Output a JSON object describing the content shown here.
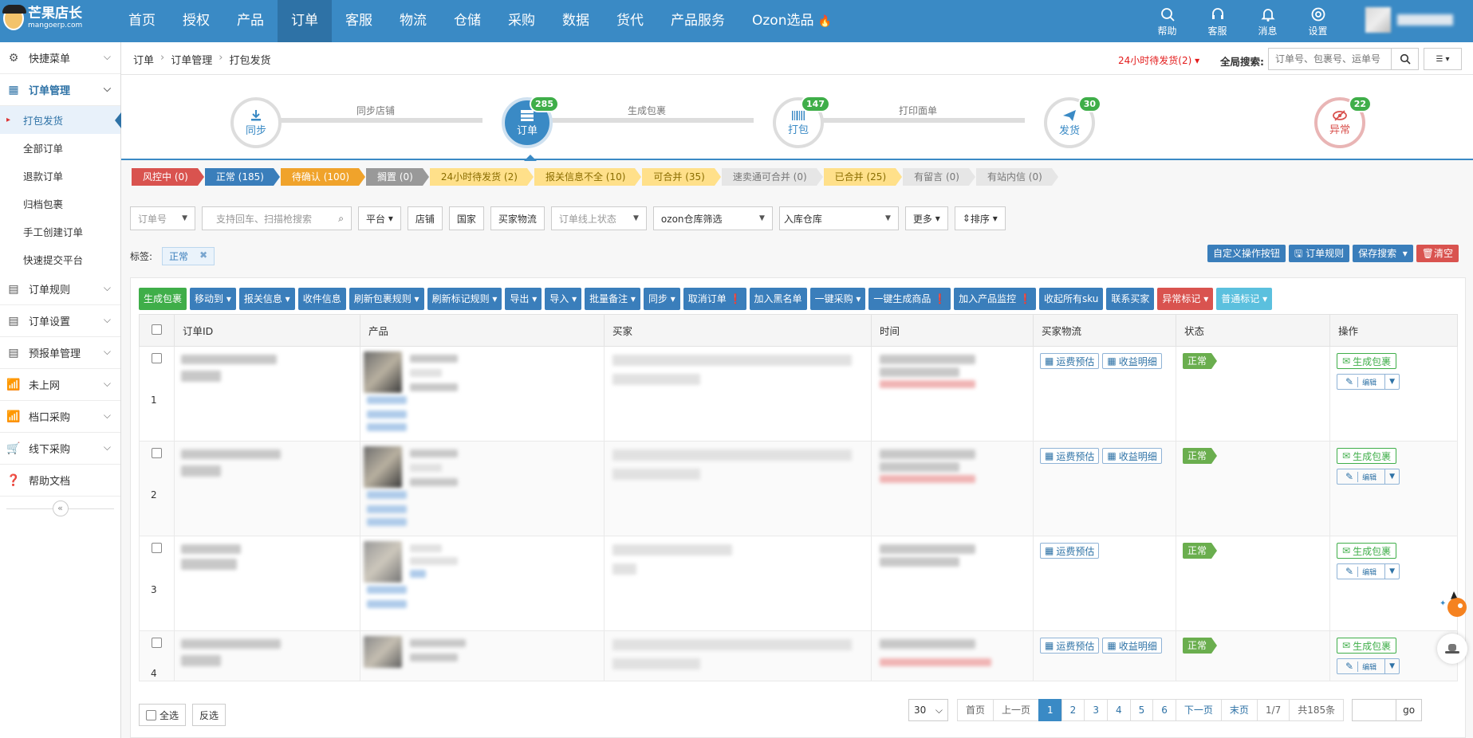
{
  "brand": {
    "name_cn": "芒果店长",
    "name_en": "mangoerp.com"
  },
  "topnav": {
    "items": [
      "首页",
      "授权",
      "产品",
      "订单",
      "客服",
      "物流",
      "仓储",
      "采购",
      "数据",
      "货代",
      "产品服务",
      "Ozon选品"
    ],
    "active": "订单",
    "icons": [
      {
        "label": "帮助",
        "icon": "search-icon"
      },
      {
        "label": "客服",
        "icon": "headset-icon"
      },
      {
        "label": "消息",
        "icon": "bell-icon"
      },
      {
        "label": "设置",
        "icon": "gear-icon"
      }
    ]
  },
  "sidebar": {
    "items": [
      {
        "label": "快捷菜单",
        "icon": "gear-icon"
      },
      {
        "label": "订单管理",
        "icon": "grid-icon"
      },
      {
        "label": "订单规则",
        "icon": "doc-icon"
      },
      {
        "label": "订单设置",
        "icon": "doc-icon"
      },
      {
        "label": "预报单管理",
        "icon": "doc-icon"
      },
      {
        "label": "未上网",
        "icon": "wifi-icon"
      },
      {
        "label": "档口采购",
        "icon": "wifi-icon"
      },
      {
        "label": "线下采购",
        "icon": "cart-icon"
      },
      {
        "label": "帮助文档",
        "icon": "question-icon"
      }
    ],
    "sub_items": [
      "打包发货",
      "全部订单",
      "退款订单",
      "归档包裹",
      "手工创建订单",
      "快速提交平台"
    ],
    "active_sub": "打包发货",
    "collapse": "«"
  },
  "breadcrumb": [
    "订单",
    "订单管理",
    "打包发货"
  ],
  "header": {
    "pending": "24小时待发货(2)",
    "global_search_label": "全局搜索:",
    "global_search_placeholder": "订单号、包裹号、运单号"
  },
  "steps": [
    {
      "label": "同步",
      "badge": ""
    },
    {
      "label": "订单",
      "badge": "285"
    },
    {
      "label": "打包",
      "badge": "147"
    },
    {
      "label": "发货",
      "badge": "30"
    },
    {
      "label": "异常",
      "badge": "22"
    }
  ],
  "step_links": [
    "同步店铺",
    "生成包裹",
    "打印面单"
  ],
  "status_tags": [
    {
      "label": "风控中 (0)",
      "style": "red"
    },
    {
      "label": "正常 (185)",
      "style": "blue"
    },
    {
      "label": "待确认 (100)",
      "style": "orange"
    },
    {
      "label": "搁置 (0)",
      "style": "gray"
    },
    {
      "label": "24小时待发货 (2)",
      "style": "yellow"
    },
    {
      "label": "报关信息不全 (10)",
      "style": "yellow"
    },
    {
      "label": "可合并 (35)",
      "style": "yellow"
    },
    {
      "label": "速卖通可合并 (0)",
      "style": "lightgray"
    },
    {
      "label": "已合并 (25)",
      "style": "yellow"
    },
    {
      "label": "有留言 (0)",
      "style": "lightgray"
    },
    {
      "label": "有站内信 (0)",
      "style": "lightgray"
    }
  ],
  "filters": {
    "order_no": "订单号",
    "scan_placeholder": "支持回车、扫描枪搜索",
    "platform": "平台",
    "shop": "店铺",
    "country": "国家",
    "buyer_logistics": "买家物流",
    "online_status": "订单线上状态",
    "ozon_warehouse": "ozon仓库筛选",
    "in_warehouse": "入库仓库",
    "more": "更多",
    "sort": "排序"
  },
  "label_filter": {
    "label": "标签:",
    "tag": "正常",
    "remove": "✖"
  },
  "right_buttons": [
    "自定义操作按钮",
    "订单规则",
    "保存搜索",
    "清空"
  ],
  "actions": [
    {
      "label": "生成包裹",
      "style": "green"
    },
    {
      "label": "移动到 ▾",
      "style": "blue"
    },
    {
      "label": "报关信息 ▾",
      "style": "blue"
    },
    {
      "label": "收件信息",
      "style": "blue"
    },
    {
      "label": "刷新包裹规则 ▾",
      "style": "blue"
    },
    {
      "label": "刷新标记规则 ▾",
      "style": "blue"
    },
    {
      "label": "导出 ▾",
      "style": "blue"
    },
    {
      "label": "导入 ▾",
      "style": "blue"
    },
    {
      "label": "批量备注 ▾",
      "style": "blue"
    },
    {
      "label": "同步 ▾",
      "style": "blue"
    },
    {
      "label": "取消订单 ❗",
      "style": "blue"
    },
    {
      "label": "加入黑名单",
      "style": "blue"
    },
    {
      "label": "一键采购 ▾",
      "style": "blue"
    },
    {
      "label": "一键生成商品 ❗",
      "style": "blue"
    },
    {
      "label": "加入产品监控 ❗",
      "style": "blue"
    },
    {
      "label": "收起所有sku",
      "style": "blue"
    },
    {
      "label": "联系买家",
      "style": "blue"
    },
    {
      "label": "异常标记 ▾",
      "style": "red"
    },
    {
      "label": "普通标记 ▾",
      "style": "lightblue"
    }
  ],
  "table": {
    "columns": [
      "订单ID",
      "产品",
      "买家",
      "时间",
      "买家物流",
      "状态",
      "操作"
    ],
    "rows": [
      {
        "num": "1",
        "status": "正常",
        "logistics": [
          "运费预估",
          "收益明细"
        ],
        "gen": "生成包裹",
        "edit": "编辑"
      },
      {
        "num": "2",
        "status": "正常",
        "logistics": [
          "运费预估",
          "收益明细"
        ],
        "gen": "生成包裹",
        "edit": "编辑"
      },
      {
        "num": "3",
        "status": "正常",
        "logistics": [
          "运费预估"
        ],
        "gen": "生成包裹",
        "edit": "编辑"
      },
      {
        "num": "4",
        "status": "正常",
        "logistics": [
          "运费预估",
          "收益明细"
        ],
        "gen": "生成包裹",
        "edit": "编辑"
      }
    ]
  },
  "footer": {
    "select_all": "全选",
    "invert": "反选",
    "page_size": "30",
    "first": "首页",
    "prev": "上一页",
    "pages": [
      "1",
      "2",
      "3",
      "4",
      "5",
      "6"
    ],
    "current_page": "1",
    "next": "下一页",
    "last": "末页",
    "page_info": "1/7",
    "total": "共185条",
    "go": "go"
  },
  "colors": {
    "nav": "#3a8ac5",
    "primary": "#3a7ebb",
    "success": "#3fae49",
    "danger": "#d9534f"
  }
}
